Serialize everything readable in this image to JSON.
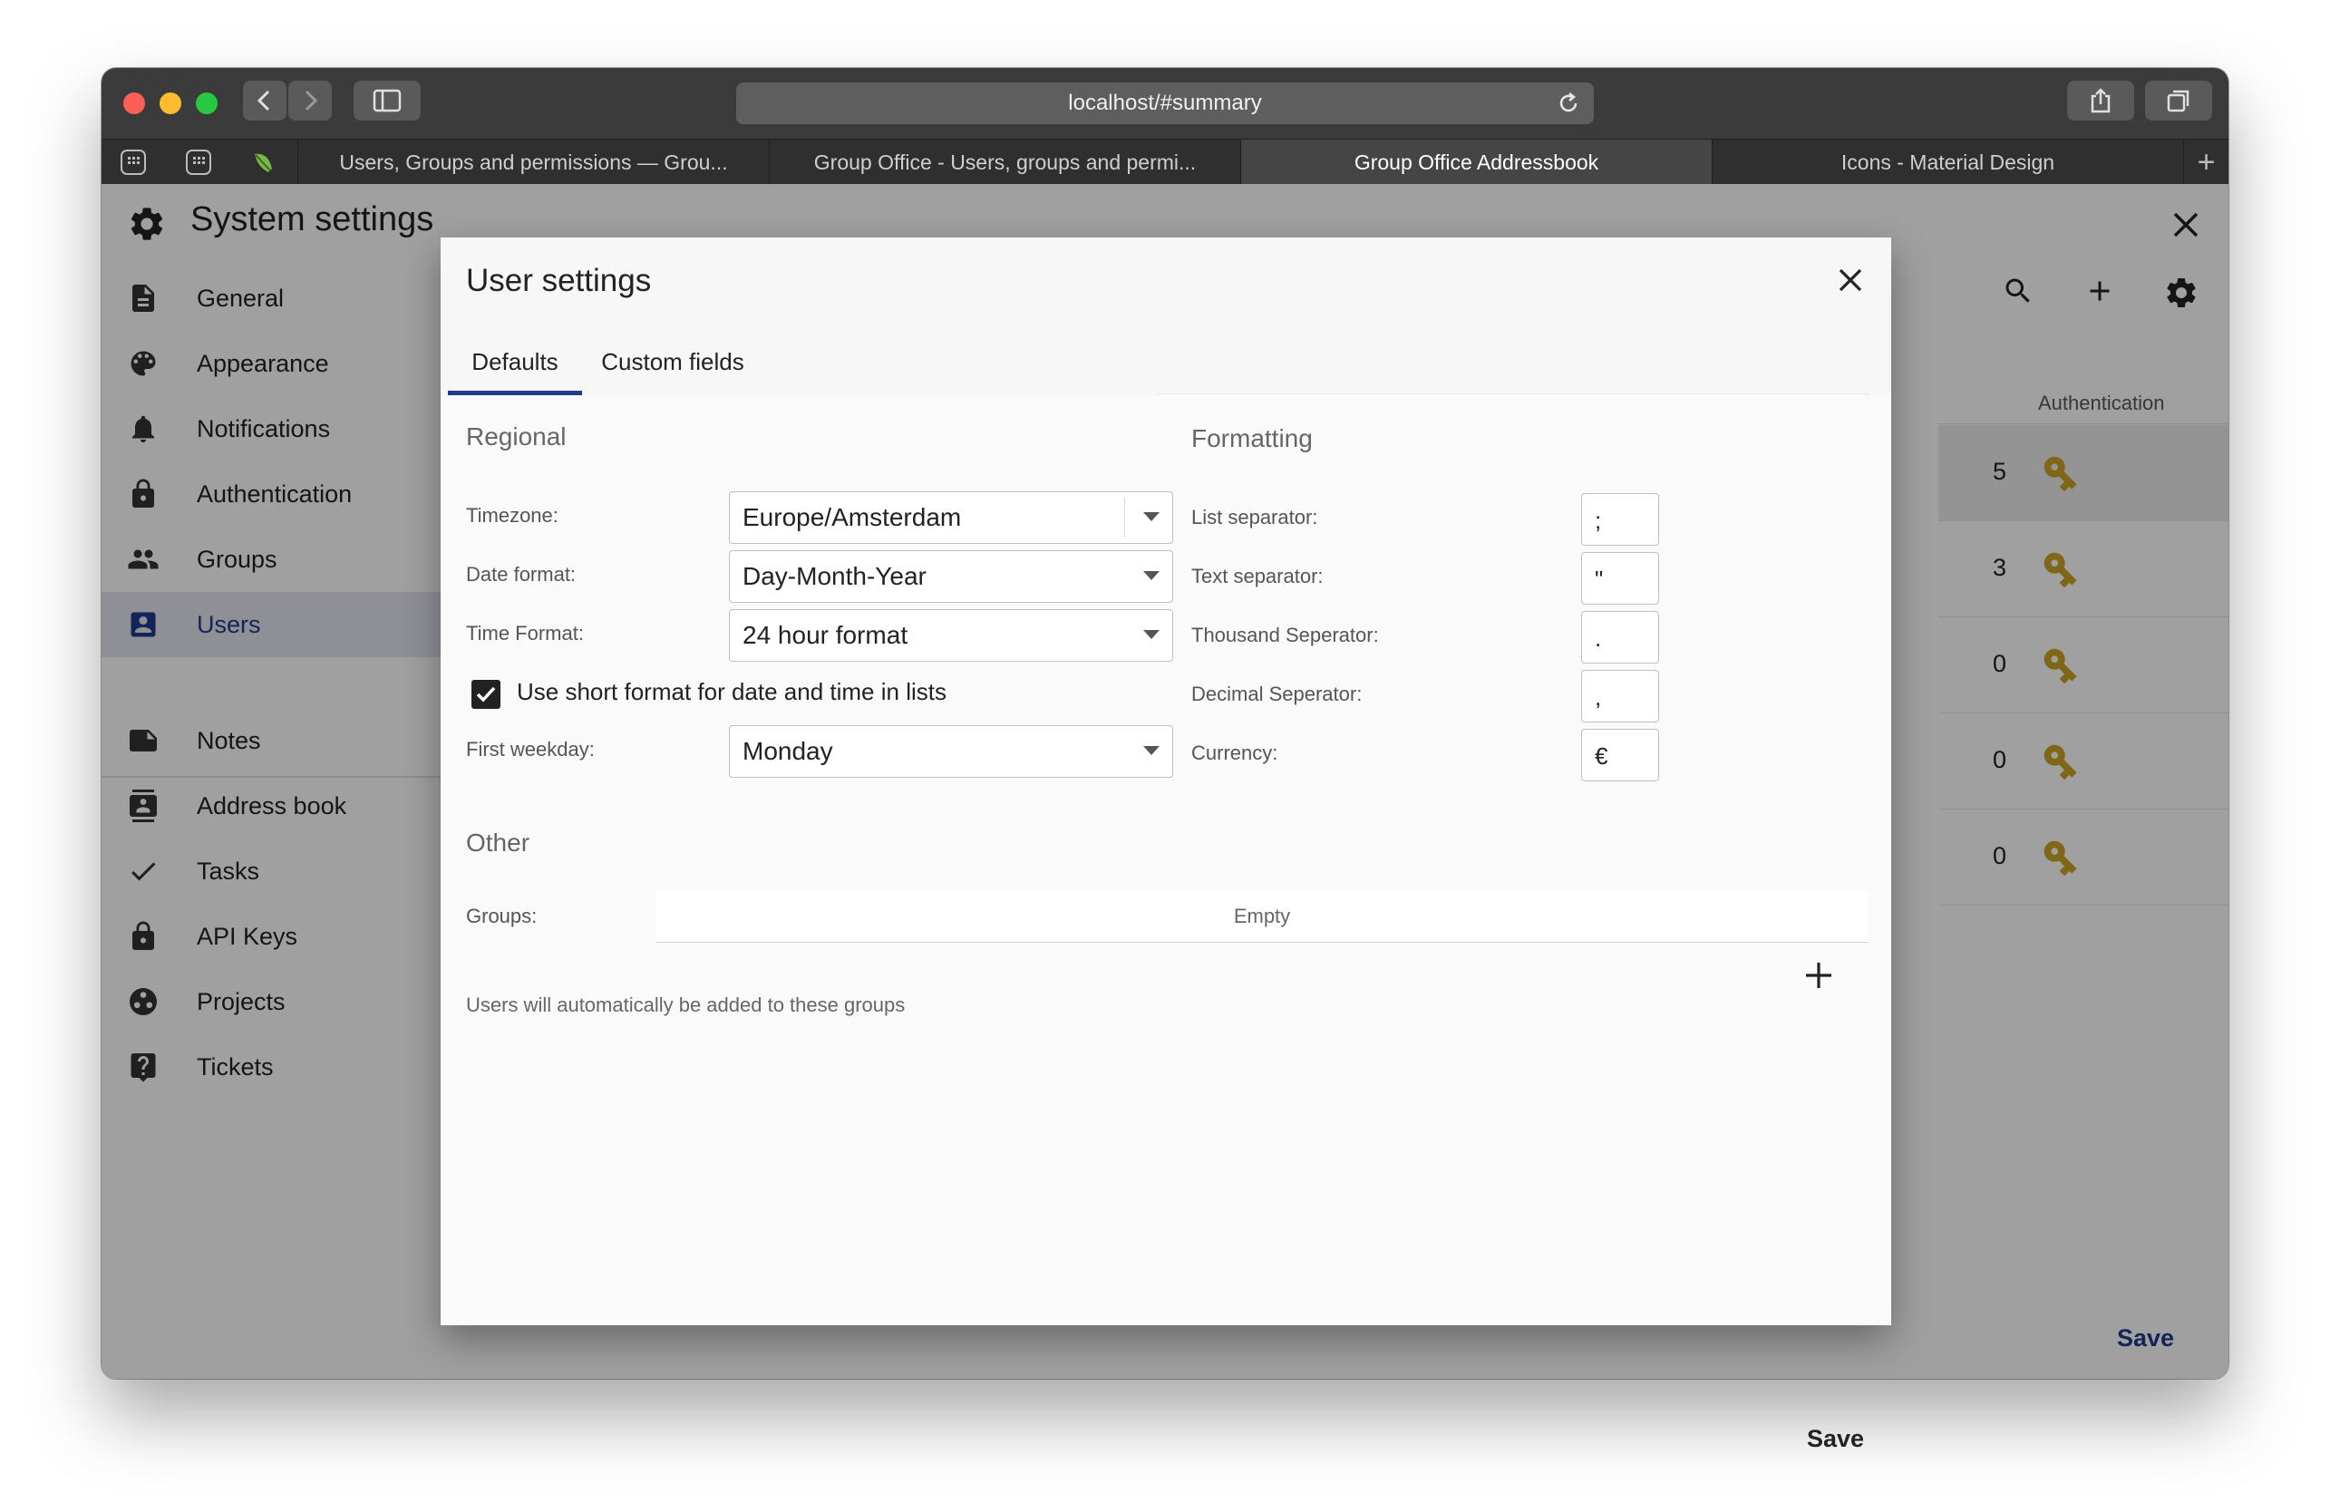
{
  "browser": {
    "url": "localhost/#summary",
    "tabs": [
      {
        "label": "Users, Groups and permissions — Grou..."
      },
      {
        "label": "Group Office - Users, groups and permi..."
      },
      {
        "label": "Group Office Addressbook"
      },
      {
        "label": "Icons - Material Design"
      }
    ],
    "new_tab_label": "+"
  },
  "app": {
    "title": "System settings",
    "sidebar": {
      "items": [
        {
          "label": "General",
          "icon": "document-icon"
        },
        {
          "label": "Appearance",
          "icon": "palette-icon"
        },
        {
          "label": "Notifications",
          "icon": "bell-icon"
        },
        {
          "label": "Authentication",
          "icon": "lock-icon"
        },
        {
          "label": "Groups",
          "icon": "people-icon"
        },
        {
          "label": "Users",
          "icon": "account-box-icon",
          "active": true
        },
        {
          "label": "Notes",
          "icon": "note-icon"
        },
        {
          "label": "Address book",
          "icon": "contacts-icon"
        },
        {
          "label": "Tasks",
          "icon": "check-icon"
        },
        {
          "label": "API Keys",
          "icon": "lock-icon"
        },
        {
          "label": "Projects",
          "icon": "projects-icon"
        },
        {
          "label": "Tickets",
          "icon": "help-icon"
        }
      ]
    },
    "table": {
      "column_header": "Authentication",
      "rows": [
        {
          "num": "5"
        },
        {
          "num": "3"
        },
        {
          "num": "0"
        },
        {
          "num": "0"
        },
        {
          "num": "0"
        }
      ]
    },
    "save_label": "Save",
    "colors": {
      "accent": "#1e3a8a",
      "key": "#c9a227"
    }
  },
  "modal": {
    "title": "User settings",
    "tabs": [
      {
        "label": "Defaults",
        "active": true
      },
      {
        "label": "Custom fields"
      }
    ],
    "regional": {
      "title": "Regional",
      "timezone_label": "Timezone:",
      "timezone_value": "Europe/Amsterdam",
      "date_format_label": "Date format:",
      "date_format_value": "Day-Month-Year",
      "time_format_label": "Time Format:",
      "time_format_value": "24 hour format",
      "short_format_label": "Use short format for date and time in lists",
      "short_format_checked": true,
      "first_weekday_label": "First weekday:",
      "first_weekday_value": "Monday"
    },
    "formatting": {
      "title": "Formatting",
      "list_separator_label": "List separator:",
      "list_separator_value": ";",
      "text_separator_label": "Text separator:",
      "text_separator_value": "\"",
      "thousand_separator_label": "Thousand Seperator:",
      "thousand_separator_value": ".",
      "decimal_separator_label": "Decimal Seperator:",
      "decimal_separator_value": ",",
      "currency_label": "Currency:",
      "currency_value": "€"
    },
    "other": {
      "title": "Other",
      "groups_label": "Groups:",
      "groups_empty": "Empty",
      "hint": "Users will automatically be added to these groups"
    },
    "save_label": "Save"
  }
}
